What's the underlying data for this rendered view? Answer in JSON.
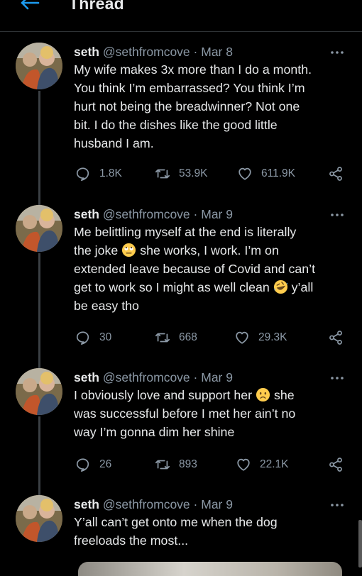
{
  "header": {
    "title": "Thread"
  },
  "tweets": [
    {
      "name": "seth",
      "handle": "@sethfromcove",
      "separator": "·",
      "date": "Mar 8",
      "lines": [
        "My wife makes 3x more than I do a month.",
        "You think I’m embarrassed? You think I’m",
        "hurt not being the breadwinner? Not one",
        "bit. I do the dishes like the good little",
        "husband I am."
      ],
      "replies": "1.8K",
      "retweets": "53.9K",
      "likes": "611.9K"
    },
    {
      "name": "seth",
      "handle": "@sethfromcove",
      "separator": "·",
      "date": "Mar 9",
      "lines": [
        "Me belittling myself at the end is literally",
        "the joke",
        "she works, I work. I’m on",
        "extended leave because of Covid and can’t",
        "get to work so I might as well clean",
        "y’all",
        "be easy tho"
      ],
      "replies": "30",
      "retweets": "668",
      "likes": "29.3K"
    },
    {
      "name": "seth",
      "handle": "@sethfromcove",
      "separator": "·",
      "date": "Mar 9",
      "lines": [
        "I obviously love and support her",
        "she",
        "was successful before I met her ain’t no",
        "way I’m gonna dim her shine"
      ],
      "replies": "26",
      "retweets": "893",
      "likes": "22.1K"
    },
    {
      "name": "seth",
      "handle": "@sethfromcove",
      "separator": "·",
      "date": "Mar 9",
      "lines": [
        "Y’all can’t get onto me when the dog",
        "freeloads the most..."
      ]
    }
  ],
  "icons": {
    "back": "back-arrow-icon",
    "more": "more-horizontal-icon",
    "reply": "reply-icon",
    "retweet": "retweet-icon",
    "like": "heart-icon",
    "share": "share-icon"
  },
  "colors": {
    "background": "#000000",
    "accent": "#1d9bf0",
    "text": "#e7e9ea",
    "muted": "#8b98a5"
  }
}
